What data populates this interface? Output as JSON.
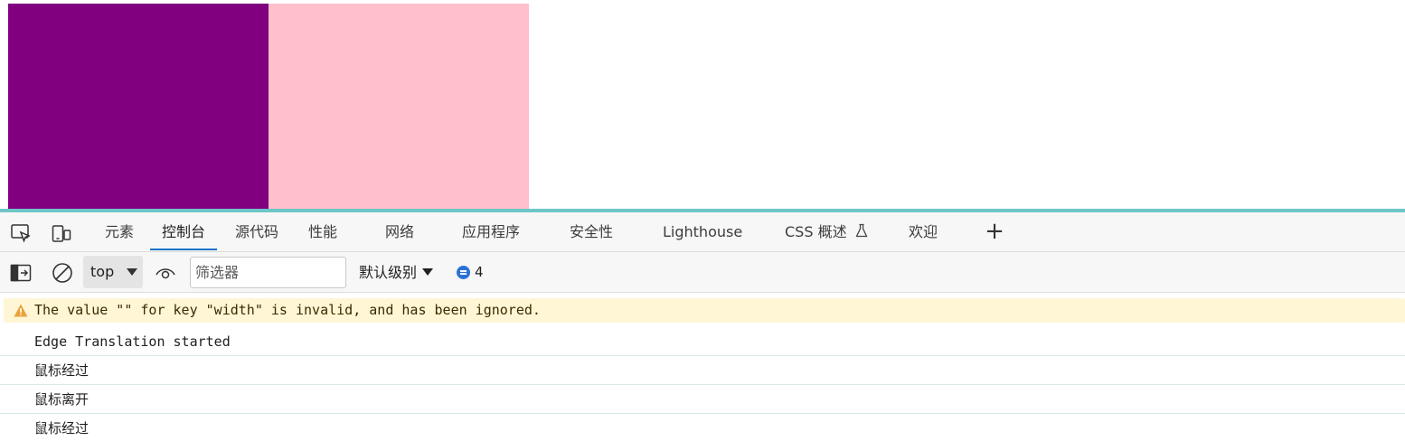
{
  "page": {
    "colors": {
      "box_left": "#800080",
      "box_right": "#ffc0cb"
    }
  },
  "devtools": {
    "tabs": [
      {
        "label": "元素"
      },
      {
        "label": "控制台",
        "active": true
      },
      {
        "label": "源代码"
      },
      {
        "label": "性能"
      },
      {
        "label": "网络"
      },
      {
        "label": "应用程序"
      },
      {
        "label": "安全性"
      },
      {
        "label": "Lighthouse"
      },
      {
        "label": "CSS 概述"
      },
      {
        "label": "欢迎"
      }
    ],
    "icons": {
      "inspect": "inspect-element-icon",
      "device": "device-toolbar-icon",
      "flask": "experiment-flask-icon",
      "add": "plus-icon",
      "sidebar": "console-sidebar-icon",
      "clear": "clear-console-icon",
      "eye": "live-expression-eye-icon",
      "warning": "warning-triangle-icon",
      "messages": "message-bubble-icon"
    },
    "toolbar": {
      "context": "top",
      "filter_placeholder": "筛选器",
      "level": "默认级别",
      "message_count": "4"
    },
    "console": {
      "warning": "The value \"\" for key \"width\" is invalid, and has been ignored.",
      "messages": [
        "Edge Translation started",
        "鼠标经过",
        "鼠标离开",
        "鼠标经过"
      ]
    },
    "colors": {
      "active_tab_underline": "#1a73c8",
      "warning_bg": "#fff6d5",
      "warning_icon": "#e8a33a",
      "resizer": "#6ec6c8"
    }
  }
}
